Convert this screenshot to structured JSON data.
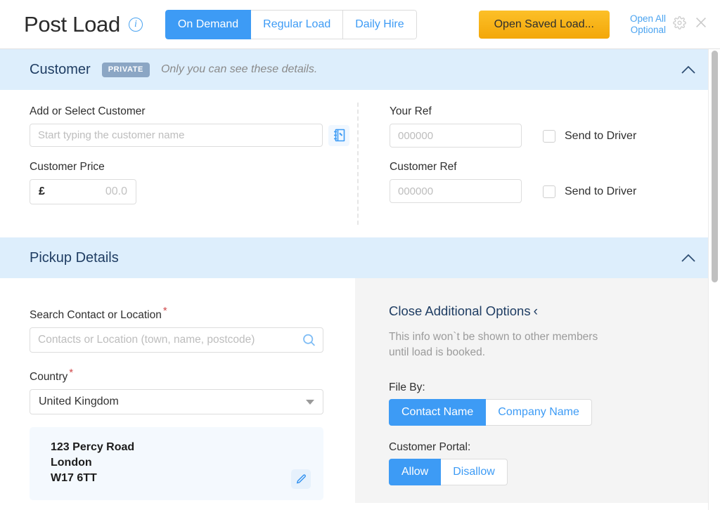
{
  "header": {
    "title": "Post Load",
    "info_icon": "info-icon",
    "tabs": [
      {
        "label": "On Demand",
        "active": true
      },
      {
        "label": "Regular Load",
        "active": false
      },
      {
        "label": "Daily Hire",
        "active": false
      }
    ],
    "saved_load_button": "Open Saved Load...",
    "open_all_optional": "Open All Optional",
    "gear_icon": "gear-icon",
    "close_icon": "close-icon",
    "accent_blue": "#3d9bf5",
    "accent_yellow": "#f3a709"
  },
  "customer_section": {
    "title": "Customer",
    "badge": "PRIVATE",
    "note": "Only you can see these details.",
    "collapse_icon": "chevron-up-icon",
    "add_customer": {
      "label": "Add or Select Customer",
      "placeholder": "Start typing the customer name",
      "value": "",
      "addressbook_icon": "address-book-icon"
    },
    "customer_price": {
      "label": "Customer Price",
      "currency": "£",
      "placeholder": "00.0",
      "value": ""
    },
    "your_ref": {
      "label": "Your Ref",
      "placeholder": "000000",
      "value": "",
      "checkbox_label": "Send to Driver",
      "checked": false
    },
    "customer_ref": {
      "label": "Customer Ref",
      "placeholder": "000000",
      "value": "",
      "checkbox_label": "Send to Driver",
      "checked": false
    }
  },
  "pickup_section": {
    "title": "Pickup Details",
    "collapse_icon": "chevron-up-icon",
    "search_contact": {
      "label": "Search Contact or Location",
      "required_marker": "*",
      "placeholder": "Contacts or Location (town, name, postcode)",
      "value": "",
      "search_icon": "search-icon"
    },
    "country": {
      "label": "Country",
      "required_marker": "*",
      "value": "United Kingdom",
      "caret_icon": "chevron-down-icon"
    },
    "address_card": {
      "lines": "123 Percy Road\nLondon\nW17 6TT",
      "edit_icon": "pencil-icon"
    },
    "additional_options": {
      "toggle_label": "Close Additional Options",
      "toggle_chevron": "‹",
      "helper_text": "This info won`t be shown to other members until load is booked.",
      "file_by": {
        "label": "File By:",
        "options": [
          {
            "label": "Contact Name",
            "active": true
          },
          {
            "label": "Company Name",
            "active": false
          }
        ]
      },
      "customer_portal": {
        "label": "Customer Portal:",
        "options": [
          {
            "label": "Allow",
            "active": true
          },
          {
            "label": "Disallow",
            "active": false
          }
        ]
      }
    }
  },
  "scrollbar": {
    "name": "vertical-scrollbar"
  }
}
